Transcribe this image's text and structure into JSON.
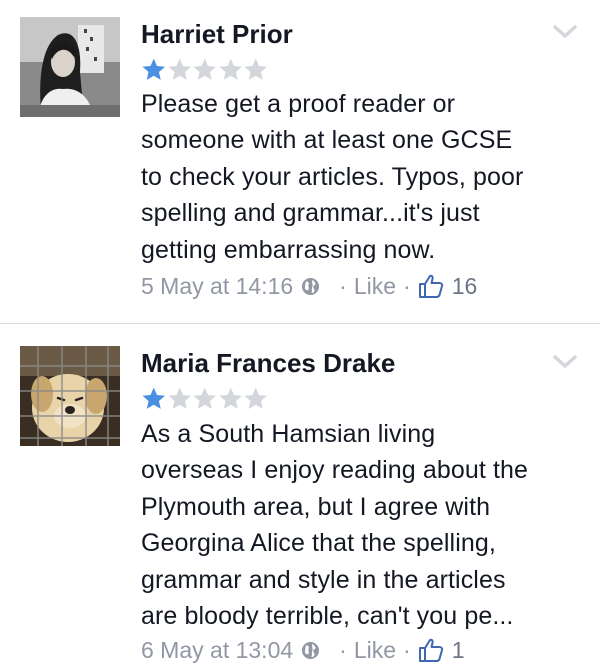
{
  "reviews": [
    {
      "author": "Harriet Prior",
      "rating": 1,
      "rating_max": 5,
      "text_lines": [
        "Please get a proof reader or",
        "someone with at least one GCSE",
        "to check your articles. Typos, poor",
        "spelling and grammar...it's just",
        "getting embarrassing now."
      ],
      "timestamp": "5 May at 14:16",
      "like_label": "Like",
      "like_count": "16"
    },
    {
      "author": "Maria Frances Drake",
      "rating": 1,
      "rating_max": 5,
      "text_lines": [
        "As a South Hamsian living",
        "overseas I enjoy reading about the",
        "Plymouth area, but I agree with",
        "Georgina Alice that the spelling,",
        "grammar and style in the articles",
        "are bloody terrible, can't you pe..."
      ],
      "timestamp": "6 May at 13:04",
      "like_label": "Like",
      "like_count": "1"
    }
  ],
  "separator": "·",
  "colors": {
    "star_filled": "#4a90e2",
    "star_empty": "#d3d6db",
    "meta_text": "#9197a3",
    "like_blue": "#4267b2"
  },
  "icons": {
    "options": "chevron-down-icon",
    "privacy": "globe-icon",
    "like": "thumbs-up-icon"
  }
}
